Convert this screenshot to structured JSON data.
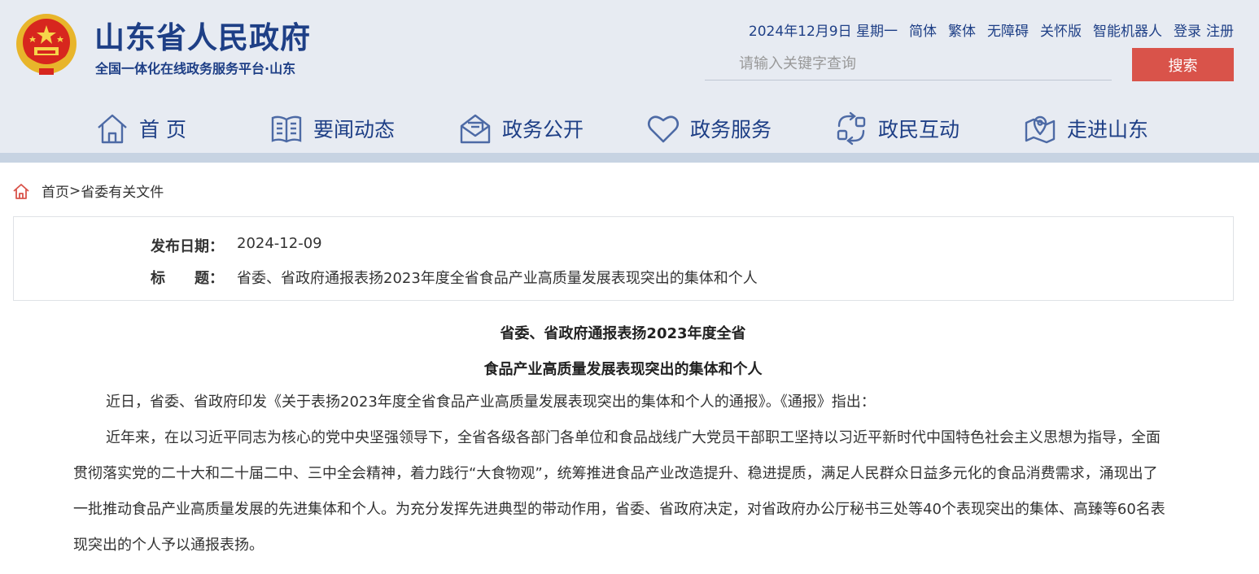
{
  "header": {
    "site_title": "山东省人民政府",
    "site_subtitle": "全国一体化在线政务服务平台·山东",
    "top_links": {
      "date": "2024年12月9日 星期一",
      "simplified": "简体",
      "traditional": "繁体",
      "accessibility": "无障碍",
      "elderly": "关怀版",
      "robot": "智能机器人",
      "login": "登录",
      "register": "注册"
    },
    "search": {
      "placeholder": "请输入关键字查询",
      "button_label": "搜索"
    }
  },
  "nav": [
    {
      "label": "首 页",
      "icon": "home-icon"
    },
    {
      "label": "要闻动态",
      "icon": "book-icon"
    },
    {
      "label": "政务公开",
      "icon": "mail-open-icon"
    },
    {
      "label": "政务服务",
      "icon": "heart-icon"
    },
    {
      "label": "政民互动",
      "icon": "interaction-icon"
    },
    {
      "label": "走进山东",
      "icon": "map-pin-icon"
    }
  ],
  "breadcrumb": {
    "home": "首页",
    "separator": ">",
    "current": "省委有关文件"
  },
  "info": {
    "date_label": "发布日期：",
    "date_value": "2024-12-09",
    "title_label": "标　　题：",
    "title_value": "省委、省政府通报表扬2023年度全省食品产业高质量发展表现突出的集体和个人"
  },
  "article": {
    "title_line1": "省委、省政府通报表扬2023年度全省",
    "title_line2": "食品产业高质量发展表现突出的集体和个人",
    "paragraphs": [
      "近日，省委、省政府印发《关于表扬2023年度全省食品产业高质量发展表现突出的集体和个人的通报》。《通报》指出：",
      "近年来，在以习近平同志为核心的党中央坚强领导下，全省各级各部门各单位和食品战线广大党员干部职工坚持以习近平新时代中国特色社会主义思想为指导，全面贯彻落实党的二十大和二十届二中、三中全会精神，着力践行“大食物观”，统筹推进食品产业改造提升、稳进提质，满足人民群众日益多元化的食品消费需求，涌现出了一批推动食品产业高质量发展的先进集体和个人。为充分发挥先进典型的带动作用，省委、省政府决定，对省政府办公厅秘书三处等40个表现突出的集体、高臻等60名表现突出的个人予以通报表扬。"
    ]
  },
  "colors": {
    "brand_blue": "#1e3f86",
    "header_bg": "#e7ebf2",
    "search_button": "#d9534a",
    "breadcrumb_icon": "#d9534a"
  }
}
